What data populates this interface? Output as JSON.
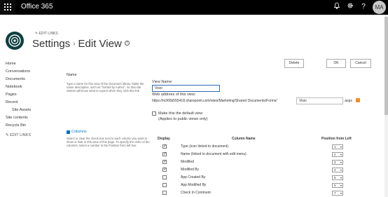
{
  "suitebar": {
    "brand": "Office 365",
    "avatar_initials": "MA",
    "bell_icon": "bell-icon",
    "gear_icon": "gear-icon",
    "help_icon": "help-icon"
  },
  "header": {
    "edit_links": "EDIT LINKS",
    "title_part1": "Settings",
    "separator": "›",
    "title_part2": "Edit View",
    "info": "i"
  },
  "nav": {
    "items": [
      {
        "label": "Home"
      },
      {
        "label": "Conversations"
      },
      {
        "label": "Documents"
      },
      {
        "label": "Notebook"
      },
      {
        "label": "Pages"
      },
      {
        "label": "Recent"
      },
      {
        "label": "Site Assets"
      },
      {
        "label": "Site contents"
      },
      {
        "label": "Recycle Bin"
      }
    ],
    "edit_links": "EDIT LINKS"
  },
  "buttons": {
    "delete": "Delete",
    "ok": "OK",
    "cancel": "Cancel"
  },
  "name_section": {
    "heading": "Name",
    "description": "Type a name for this view of the document library. Make the name descriptive, such as \"Sorted by Author\", so that site visitors will know what to expect when they click this link.",
    "view_name_label": "View Name:",
    "view_name_value": "Visio",
    "web_address_label": "Web address of this view:",
    "web_address_prefix": "https://m365b555418.sharepoint.com/sites/Marketing/Shared Documents/Forms/",
    "web_address_value": "Visio",
    "web_address_suffix": ".aspx",
    "default_view_label": "Make this the default view",
    "default_view_note": "(Applies to public views only)"
  },
  "columns_section": {
    "heading": "Columns",
    "description": "Select or clear the check box next to each column you want to show or hide in this view of this page. To specify the order of the columns, select a number in the Position from left box.",
    "headers": {
      "display": "Display",
      "column_name": "Column Name",
      "position": "Position from Left"
    },
    "rows": [
      {
        "name": "Type (icon linked to document)",
        "checked": true,
        "position": "1"
      },
      {
        "name": "Name (linked to document with edit menu)",
        "checked": true,
        "position": "2"
      },
      {
        "name": "Modified",
        "checked": true,
        "position": "3"
      },
      {
        "name": "Modified By",
        "checked": true,
        "position": "4"
      },
      {
        "name": "App Created By",
        "checked": false,
        "position": "5"
      },
      {
        "name": "App Modified By",
        "checked": false,
        "position": "6"
      },
      {
        "name": "Check In Comment",
        "checked": false,
        "position": "7"
      }
    ]
  }
}
